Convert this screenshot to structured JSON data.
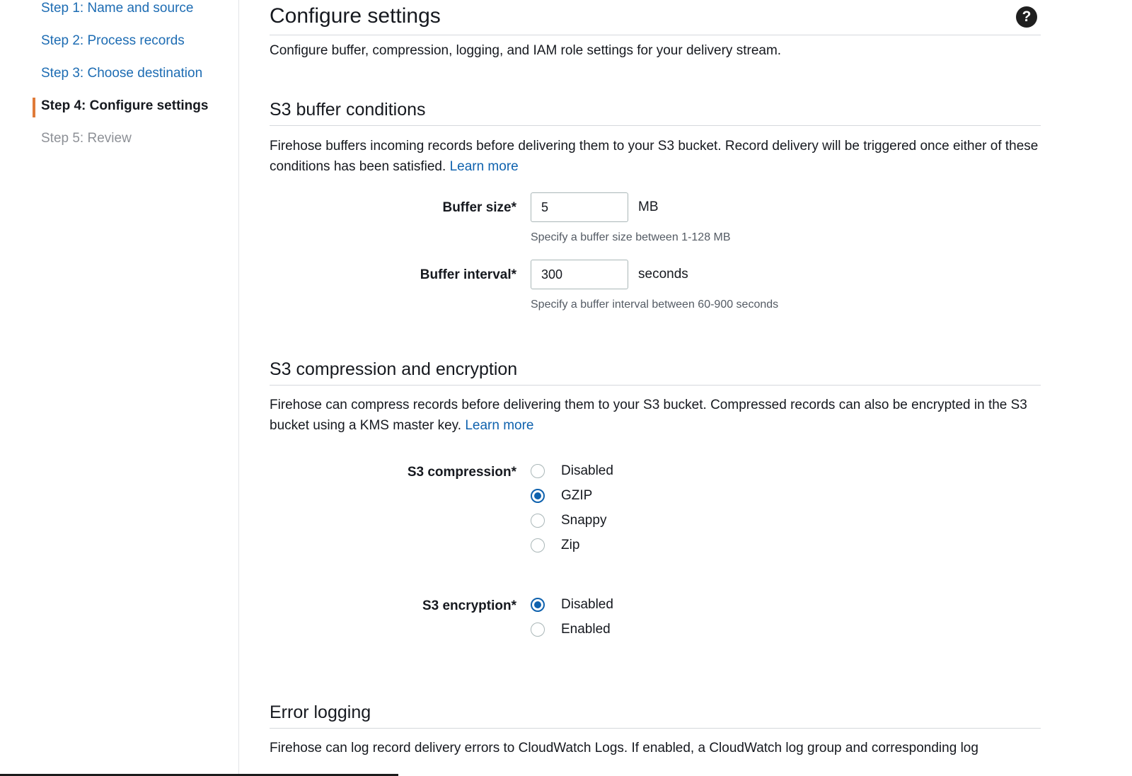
{
  "steps": [
    {
      "label": "Step 1: Name and source",
      "state": "link"
    },
    {
      "label": "Step 2: Process records",
      "state": "link"
    },
    {
      "label": "Step 3: Choose destination",
      "state": "link"
    },
    {
      "label": "Step 4: Configure settings",
      "state": "active"
    },
    {
      "label": "Step 5: Review",
      "state": "disabled"
    }
  ],
  "page": {
    "title": "Configure settings",
    "description": "Configure buffer, compression, logging, and IAM role settings for your delivery stream.",
    "help_icon": "question-circle-icon"
  },
  "buffer": {
    "title": "S3 buffer conditions",
    "description": "Firehose buffers incoming records before delivering them to your S3 bucket. Record delivery will be triggered once either of these conditions has been satisfied.",
    "learn_more": "Learn more",
    "size_label": "Buffer size*",
    "size_value": "5",
    "size_unit": "MB",
    "size_hint": "Specify a buffer size between 1-128 MB",
    "interval_label": "Buffer interval*",
    "interval_value": "300",
    "interval_unit": "seconds",
    "interval_hint": "Specify a buffer interval between 60-900 seconds"
  },
  "compression": {
    "title": "S3 compression and encryption",
    "description": "Firehose can compress records before delivering them to your S3 bucket. Compressed records can also be encrypted in the S3 bucket using a KMS master key.",
    "learn_more": "Learn more",
    "compression_label": "S3 compression*",
    "compression_options": [
      "Disabled",
      "GZIP",
      "Snappy",
      "Zip"
    ],
    "compression_selected": "GZIP",
    "encryption_label": "S3 encryption*",
    "encryption_options": [
      "Disabled",
      "Enabled"
    ],
    "encryption_selected": "Disabled"
  },
  "logging": {
    "title": "Error logging",
    "description": "Firehose can log record delivery errors to CloudWatch Logs. If enabled, a CloudWatch log group and corresponding log"
  },
  "colors": {
    "accent": "#0f62ae",
    "link": "#1d6cb3",
    "active_step_marker": "#e07b39",
    "disabled_text": "#8d9096"
  }
}
